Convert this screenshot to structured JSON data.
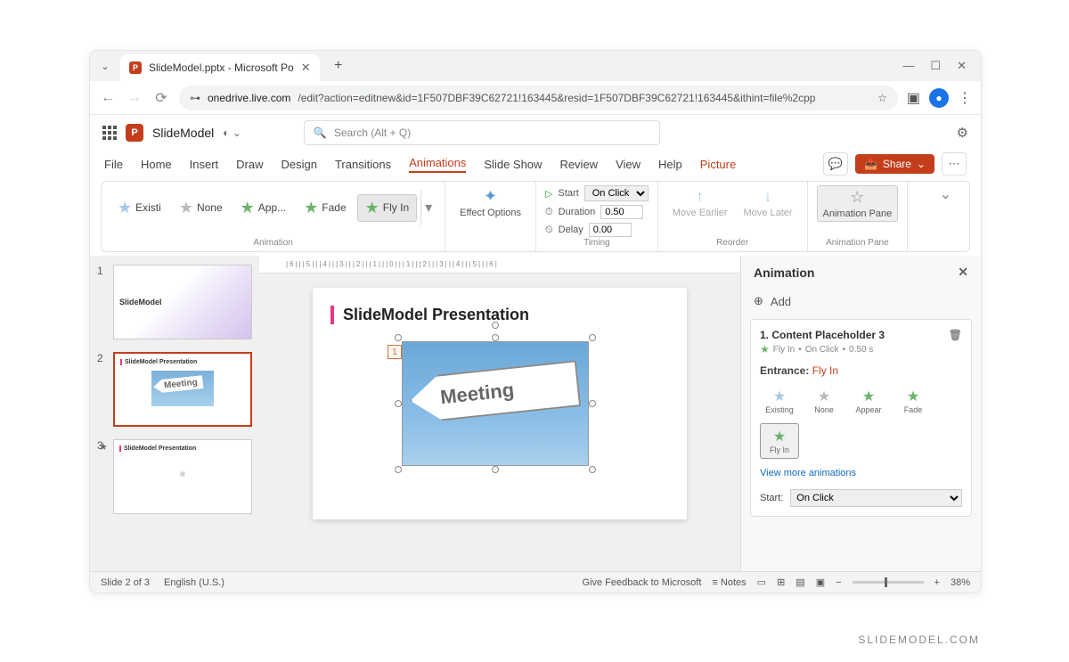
{
  "browser": {
    "tab_title": "SlideModel.pptx - Microsoft Po",
    "url_host": "onedrive.live.com",
    "url_path": "/edit?action=editnew&id=1F507DBF39C62721!163445&resid=1F507DBF39C62721!163445&ithint=file%2cpp"
  },
  "app": {
    "doc_name": "SlideModel",
    "search_placeholder": "Search (Alt + Q)",
    "menus": [
      "File",
      "Home",
      "Insert",
      "Draw",
      "Design",
      "Transitions",
      "Animations",
      "Slide Show",
      "Review",
      "View",
      "Help",
      "Picture"
    ],
    "active_menu": "Animations",
    "share_label": "Share"
  },
  "ribbon": {
    "animations": [
      {
        "label": "Existi",
        "star": "blue"
      },
      {
        "label": "None",
        "star": "grey"
      },
      {
        "label": "App...",
        "star": "green"
      },
      {
        "label": "Fade",
        "star": "green"
      },
      {
        "label": "Fly In",
        "star": "green",
        "selected": true
      }
    ],
    "effect_options": "Effect Options",
    "group_animation": "Animation",
    "start_label": "Start",
    "start_value": "On Click",
    "duration_label": "Duration",
    "duration_value": "0.50",
    "delay_label": "Delay",
    "delay_value": "0.00",
    "group_timing": "Timing",
    "move_earlier": "Move Earlier",
    "move_later": "Move Later",
    "group_reorder": "Reorder",
    "anim_pane": "Animation Pane",
    "group_pane": "Animation Pane"
  },
  "thumbs": [
    {
      "num": "1",
      "title": "SlideModel"
    },
    {
      "num": "2",
      "title": "SlideModel Presentation",
      "active": true,
      "has_anim": true
    },
    {
      "num": "3",
      "title": "SlideModel Presentation"
    }
  ],
  "slide": {
    "title": "SlideModel Presentation",
    "image_text": "Meeting",
    "tag": "1"
  },
  "pane": {
    "header": "Animation",
    "add": "Add",
    "item_num": "1.",
    "item_title": "Content Placeholder 3",
    "item_sub_effect": "Fly In",
    "item_sub_trigger": "On Click",
    "item_sub_time": "0.50 s",
    "entrance_label": "Entrance:",
    "entrance_value": "Fly In",
    "options": [
      {
        "label": "Existing",
        "star": "blue"
      },
      {
        "label": "None",
        "star": "grey"
      },
      {
        "label": "Appear",
        "star": "green"
      },
      {
        "label": "Fade",
        "star": "green"
      },
      {
        "label": "Fly In",
        "star": "green",
        "selected": true
      }
    ],
    "more_link": "View more animations",
    "start_label": "Start:",
    "start_value": "On Click"
  },
  "status": {
    "slide": "Slide 2 of 3",
    "lang": "English (U.S.)",
    "feedback": "Give Feedback to Microsoft",
    "notes": "Notes",
    "zoom": "38%"
  },
  "footer": "SLIDEMODEL.COM"
}
